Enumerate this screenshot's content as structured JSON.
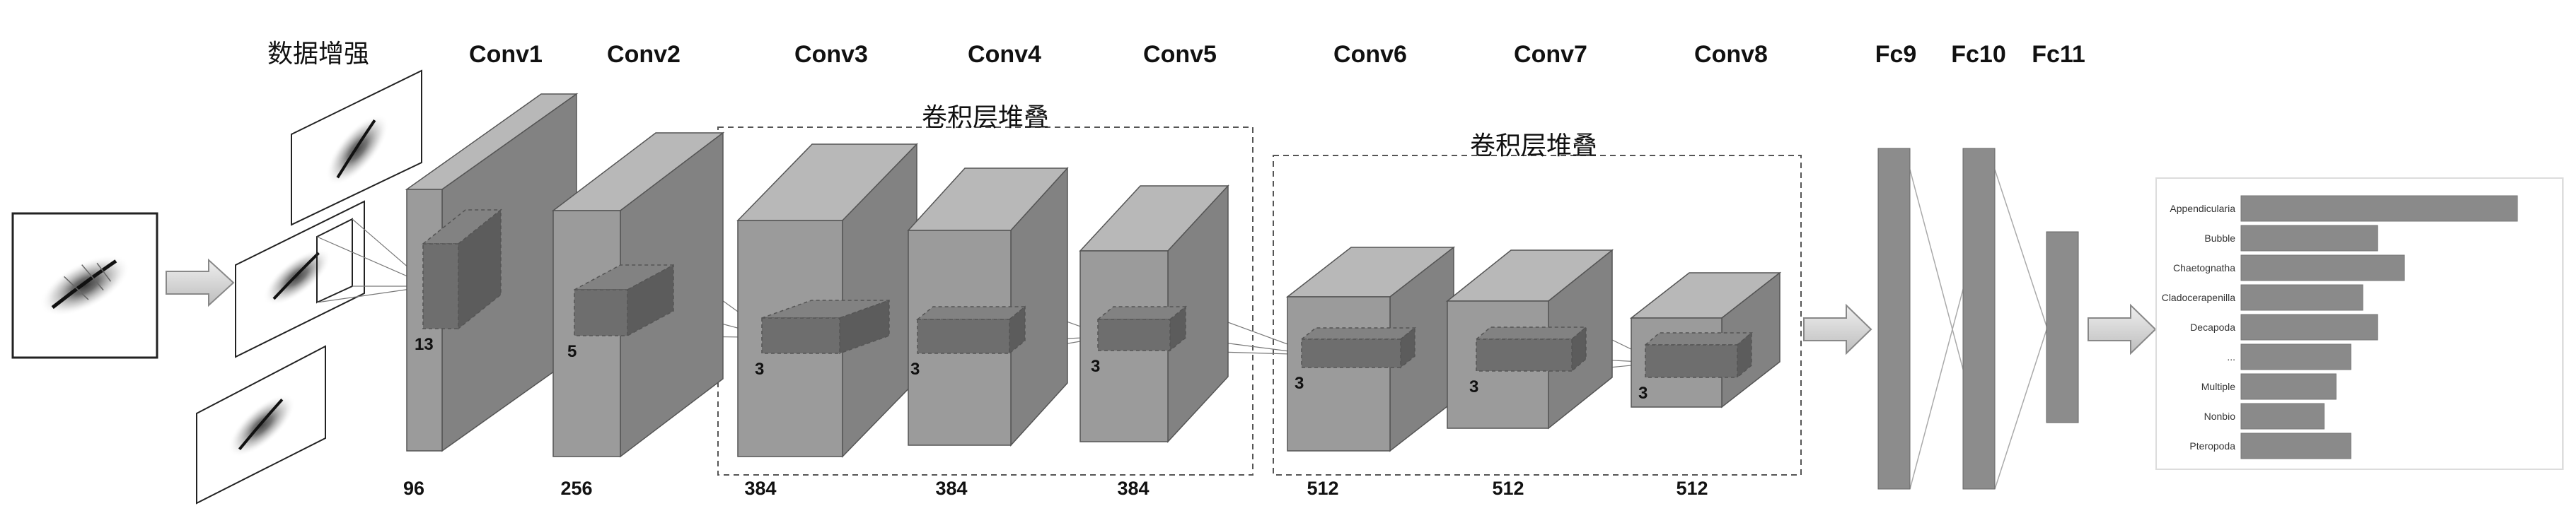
{
  "augmentation_label": "数据增强",
  "layers": [
    {
      "name": "Conv1",
      "channels": "96",
      "kernel": "13"
    },
    {
      "name": "Conv2",
      "channels": "256",
      "kernel": "5"
    },
    {
      "name": "Conv3",
      "channels": "384",
      "kernel": "3"
    },
    {
      "name": "Conv4",
      "channels": "384",
      "kernel": "3"
    },
    {
      "name": "Conv5",
      "channels": "384",
      "kernel": "3"
    },
    {
      "name": "Conv6",
      "channels": "512",
      "kernel": "3"
    },
    {
      "name": "Conv7",
      "channels": "512",
      "kernel": "3"
    },
    {
      "name": "Conv8",
      "channels": "512",
      "kernel": "3"
    }
  ],
  "fc_layers": [
    "Fc9",
    "Fc10",
    "Fc11"
  ],
  "groups": [
    "卷积层堆叠",
    "卷积层堆叠"
  ],
  "chart_data": {
    "type": "bar",
    "orientation": "horizontal",
    "categories": [
      "Appendicularia",
      "Bubble",
      "Chaetognatha",
      "Cladocerapenilla",
      "Decapoda",
      "...",
      "Multiple",
      "Nonbio",
      "Pteropoda"
    ],
    "values": [
      0.93,
      0.46,
      0.55,
      0.41,
      0.46,
      0.37,
      0.32,
      0.28,
      0.37
    ],
    "xlim": [
      0,
      1
    ],
    "title": "",
    "xlabel": "",
    "ylabel": "",
    "bar_color": "#8a8a8a"
  },
  "colors": {
    "block_front": "#9b9b9b",
    "block_top": "#b8b8b8",
    "block_side": "#828282",
    "kernel_front": "#6e6e6e",
    "kernel_top": "#828282",
    "kernel_side": "#5c5c5c",
    "fc_bar": "#8c8c8c",
    "arrow_fill": "#d7d7d7"
  }
}
